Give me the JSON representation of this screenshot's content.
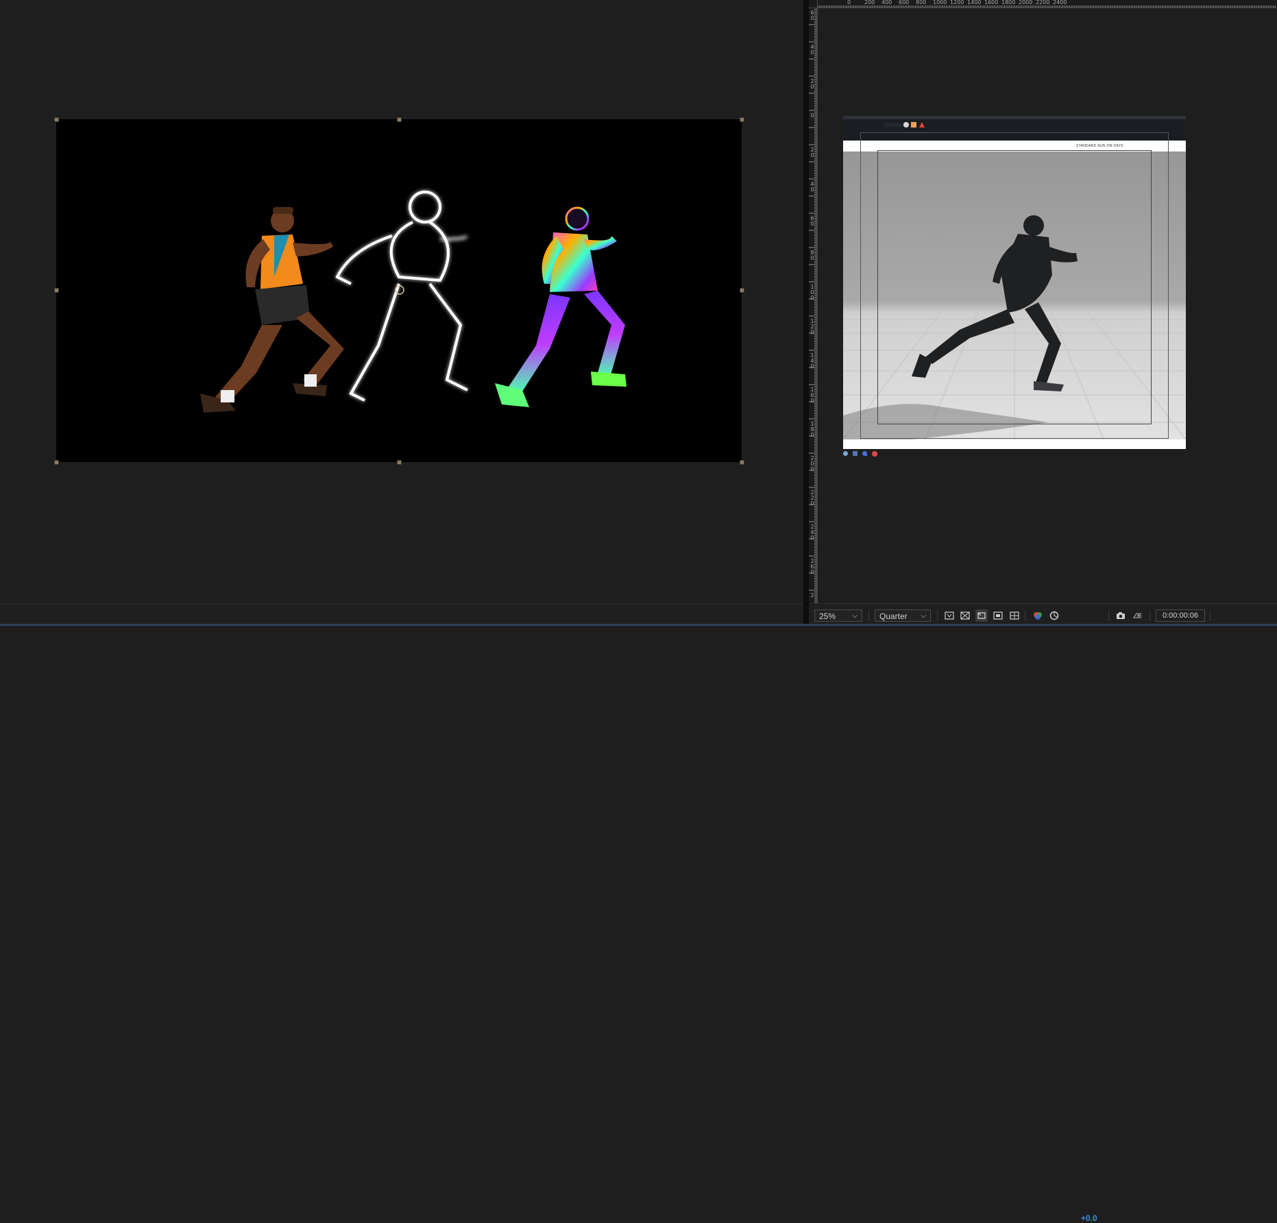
{
  "left_viewer": {
    "comp_description_icon": "runner-trio-artwork"
  },
  "right_viewer": {
    "ruler_top_labels": [
      "0",
      "200",
      "400",
      "600",
      "800",
      "1000",
      "1200",
      "1400",
      "1600",
      "1800",
      "2000",
      "2200",
      "2400"
    ],
    "ruler_left_labels": [
      "60",
      "40",
      "20",
      "0",
      "20",
      "40",
      "60",
      "80",
      "100",
      "120",
      "140",
      "160",
      "180",
      "200",
      "220",
      "240",
      "260",
      "2"
    ],
    "preview_banner_text": "STANDARD RUN ON DAYS"
  },
  "toolbar": {
    "zoom": "25%",
    "resolution": "Quarter",
    "exposure": "+0.0",
    "timecode": "0:00:00:06",
    "icons": [
      "region-of-interest-icon",
      "transparency-grid-icon",
      "mask-visibility-icon",
      "safe-zones-icon",
      "grid-guides-icon",
      "color-channels-icon",
      "reset-exposure-icon",
      "snapshot-icon",
      "show-snapshot-icon"
    ]
  },
  "colors": {
    "background": "#1e1e1e",
    "accent_blue": "#3c8ef0",
    "handle": "#8a7d67"
  }
}
